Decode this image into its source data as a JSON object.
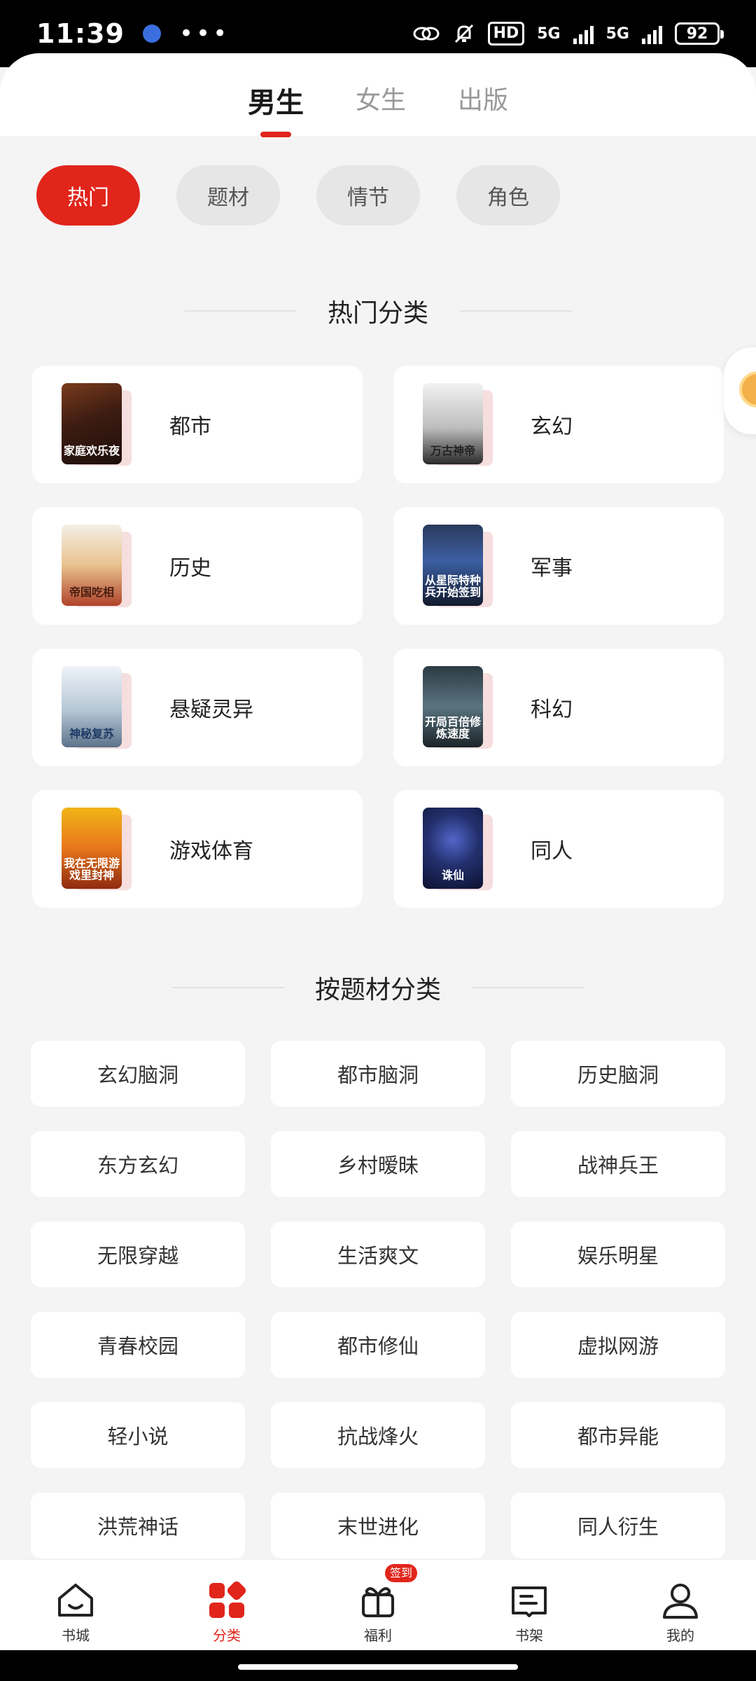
{
  "status_bar": {
    "time": "11:39",
    "more": "•••",
    "hd": "HD",
    "net1": "5G",
    "net2": "5G",
    "battery": "92"
  },
  "gender_tabs": [
    {
      "label": "男生",
      "active": true
    },
    {
      "label": "女生",
      "active": false
    },
    {
      "label": "出版",
      "active": false
    }
  ],
  "filter_pills": [
    {
      "label": "热门",
      "active": true
    },
    {
      "label": "题材",
      "active": false
    },
    {
      "label": "情节",
      "active": false
    },
    {
      "label": "角色",
      "active": false
    }
  ],
  "hot_section": {
    "title": "热门分类",
    "items": [
      {
        "label": "都市",
        "cover_text": "家庭欢乐夜"
      },
      {
        "label": "玄幻",
        "cover_text": "万古神帝"
      },
      {
        "label": "历史",
        "cover_text": "帝国吃相"
      },
      {
        "label": "军事",
        "cover_text": "从星际特种兵开始签到"
      },
      {
        "label": "悬疑灵异",
        "cover_text": "神秘复苏"
      },
      {
        "label": "科幻",
        "cover_text": "开局百倍修炼速度"
      },
      {
        "label": "游戏体育",
        "cover_text": "我在无限游戏里封神"
      },
      {
        "label": "同人",
        "cover_text": "诛仙"
      }
    ]
  },
  "topic_section": {
    "title": "按题材分类",
    "tags": [
      "玄幻脑洞",
      "都市脑洞",
      "历史脑洞",
      "东方玄幻",
      "乡村暧昧",
      "战神兵王",
      "无限穿越",
      "生活爽文",
      "娱乐明星",
      "青春校园",
      "都市修仙",
      "虚拟网游",
      "轻小说",
      "抗战烽火",
      "都市异能",
      "洪荒神话",
      "末世进化",
      "同人衍生"
    ]
  },
  "bottom_nav": {
    "items": [
      {
        "label": "书城",
        "icon": "home-icon",
        "active": false
      },
      {
        "label": "分类",
        "icon": "category-icon",
        "active": true
      },
      {
        "label": "福利",
        "icon": "gift-icon",
        "active": false
      },
      {
        "label": "书架",
        "icon": "bookshelf-icon",
        "active": false
      },
      {
        "label": "我的",
        "icon": "profile-icon",
        "active": false
      }
    ],
    "badge": "签到"
  },
  "colors": {
    "accent": "#e1251b",
    "background": "#f4f4f4"
  }
}
